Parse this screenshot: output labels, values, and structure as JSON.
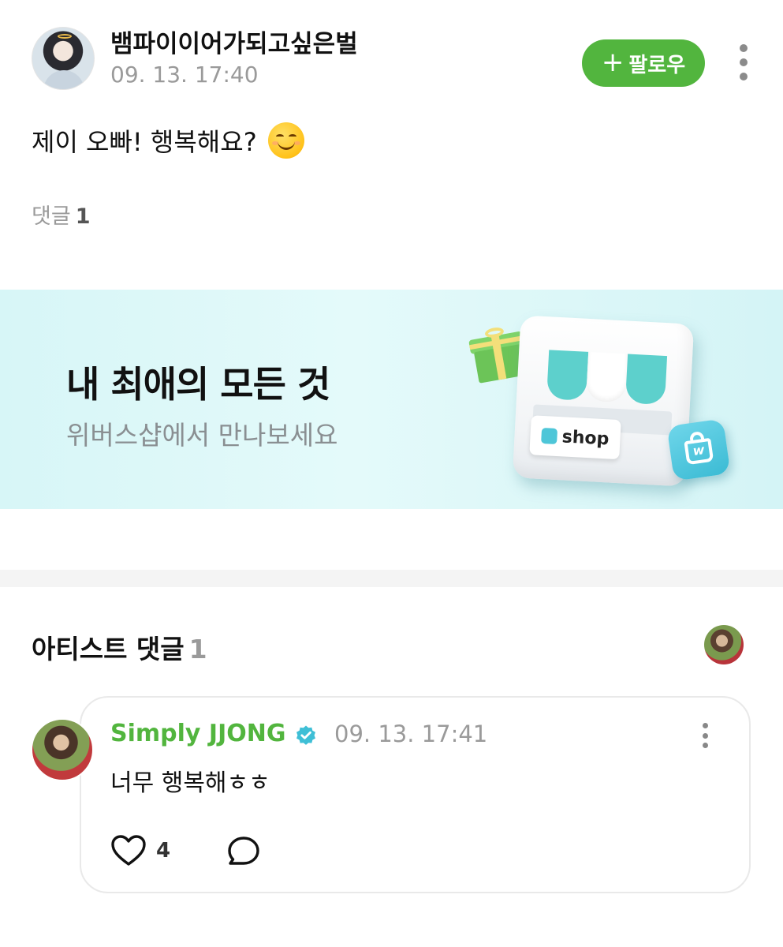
{
  "post": {
    "author_name": "뱀파이이어가되고싶은벌",
    "timestamp": "09. 13. 17:40",
    "follow_label": "팔로우",
    "text": "제이 오빠! 행복해요?",
    "comments_label": "댓글",
    "comments_count": "1"
  },
  "banner": {
    "title": "내 최애의 모든 것",
    "subtitle": "위버스샵에서 만나보세요",
    "sign_label": "shop",
    "bag_letter": "w"
  },
  "artist_comments": {
    "section_label": "아티스트 댓글",
    "count": "1",
    "comments": [
      {
        "author_name": "Simply JJONG",
        "timestamp": "09. 13. 17:41",
        "text": "너무 행복해ㅎㅎ",
        "like_count": "4"
      }
    ]
  },
  "colors": {
    "accent_green": "#52b53e",
    "verified_blue": "#3fbfd6",
    "banner_bg": "#dcf7f8",
    "meta_gray": "#9a9a9a"
  },
  "icons": {
    "follow": "plus-icon",
    "post_menu": "more-vertical-icon",
    "emoji": "smiling-face-emoji",
    "verified": "verified-check-icon",
    "like": "heart-icon",
    "reply": "speech-bubble-icon"
  }
}
